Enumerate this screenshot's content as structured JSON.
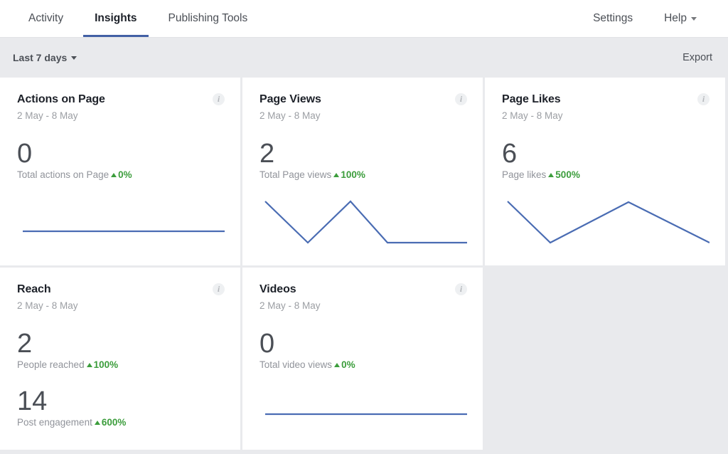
{
  "nav": {
    "tabs": [
      {
        "label": "Activity",
        "active": false
      },
      {
        "label": "Insights",
        "active": true
      },
      {
        "label": "Publishing Tools",
        "active": false
      }
    ],
    "right": [
      {
        "label": "Settings",
        "caret": false
      },
      {
        "label": "Help",
        "caret": true
      }
    ]
  },
  "toolbar": {
    "date_range_label": "Last 7 days",
    "export_label": "Export"
  },
  "colors": {
    "line": "#4a6cb3",
    "positive": "#3c9d3c",
    "accent": "#4260a5",
    "background": "#e9eaed",
    "card": "#ffffff"
  },
  "cards": [
    {
      "title": "Actions on Page",
      "date": "2 May - 8 May",
      "info_icon": "info-icon",
      "metrics": [
        {
          "value": "0",
          "label": "Total actions on Page",
          "delta": "0%",
          "direction": "up"
        }
      ],
      "chart_data": {
        "type": "line",
        "title": "Actions on Page",
        "x": [
          0,
          1,
          2,
          3,
          4,
          5,
          6
        ],
        "values": [
          0,
          0,
          0,
          0,
          0,
          0,
          0
        ],
        "ylim": [
          0,
          1
        ],
        "grid": false,
        "legend": "none"
      }
    },
    {
      "title": "Page Views",
      "date": "2 May - 8 May",
      "info_icon": "info-icon",
      "metrics": [
        {
          "value": "2",
          "label": "Total Page views",
          "delta": "100%",
          "direction": "up"
        }
      ],
      "chart_data": {
        "type": "line",
        "title": "Page Views",
        "x": [
          0,
          1,
          2,
          3,
          4,
          5,
          6
        ],
        "values": [
          1,
          0.5,
          0,
          0.5,
          1,
          0,
          0
        ],
        "ylim": [
          0,
          1
        ],
        "grid": false,
        "legend": "none"
      }
    },
    {
      "title": "Page Likes",
      "date": "2 May - 8 May",
      "info_icon": "info-icon",
      "metrics": [
        {
          "value": "6",
          "label": "Page likes",
          "delta": "500%",
          "direction": "up"
        }
      ],
      "chart_data": {
        "type": "line",
        "title": "Page Likes",
        "x": [
          0,
          1,
          2,
          3,
          4,
          5,
          6
        ],
        "values": [
          1,
          0.48,
          0,
          0.5,
          1,
          0.5,
          0
        ],
        "ylim": [
          0,
          1
        ],
        "grid": false,
        "legend": "none"
      }
    },
    {
      "title": "Reach",
      "date": "2 May - 8 May",
      "info_icon": "info-icon",
      "metrics": [
        {
          "value": "2",
          "label": "People reached",
          "delta": "100%",
          "direction": "up"
        },
        {
          "value": "14",
          "label": "Post engagement",
          "delta": "600%",
          "direction": "up"
        }
      ],
      "chart_data": null
    },
    {
      "title": "Videos",
      "date": "2 May - 8 May",
      "info_icon": "info-icon",
      "metrics": [
        {
          "value": "0",
          "label": "Total video views",
          "delta": "0%",
          "direction": "up"
        }
      ],
      "chart_data": {
        "type": "line",
        "title": "Videos",
        "x": [
          0,
          1,
          2,
          3,
          4,
          5,
          6
        ],
        "values": [
          0,
          0,
          0,
          0,
          0,
          0,
          0
        ],
        "ylim": [
          0,
          1
        ],
        "grid": false,
        "legend": "none"
      }
    }
  ]
}
